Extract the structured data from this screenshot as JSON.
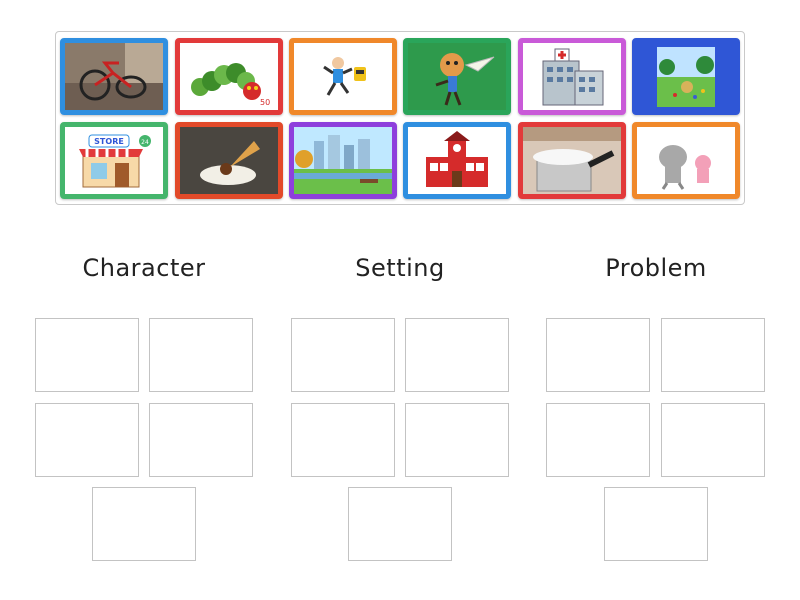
{
  "cards": [
    {
      "id": "bike",
      "border": "#2f8fe0"
    },
    {
      "id": "caterpillar",
      "border": "#e23a3a"
    },
    {
      "id": "runner",
      "border": "#f0882a"
    },
    {
      "id": "boy-airplane",
      "border": "#2aa55a"
    },
    {
      "id": "hospital",
      "border": "#c95ad8"
    },
    {
      "id": "park-people",
      "border": "#2f56d6"
    },
    {
      "id": "store",
      "border": "#45b56c"
    },
    {
      "id": "icecream",
      "border": "#e24a2a"
    },
    {
      "id": "city-park",
      "border": "#8e3fdc"
    },
    {
      "id": "school",
      "border": "#2f8fe0"
    },
    {
      "id": "pot-overflow",
      "border": "#e23a3a"
    },
    {
      "id": "elephant-pig",
      "border": "#f0882a"
    }
  ],
  "store_sign": "STORE",
  "store_badge": "24",
  "caterpillar_badge": "50",
  "categories": [
    {
      "label": "Character"
    },
    {
      "label": "Setting"
    },
    {
      "label": "Problem"
    }
  ]
}
